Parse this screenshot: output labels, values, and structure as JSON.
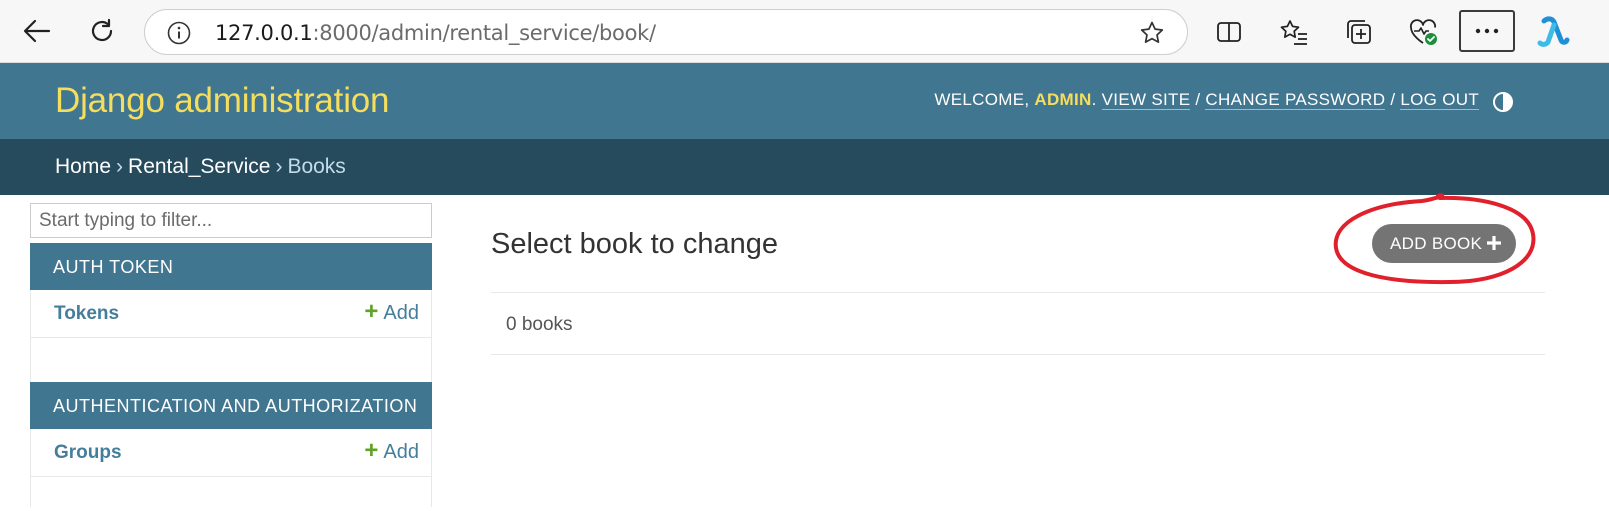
{
  "browser": {
    "url_host": "127.0.0.1",
    "url_path": ":8000/admin/rental_service/book/"
  },
  "header": {
    "branding": "Django administration",
    "welcome": "WELCOME,",
    "username": "ADMIN",
    "view_site": "VIEW SITE",
    "change_password": "CHANGE PASSWORD",
    "log_out": "LOG OUT",
    "sep": "/"
  },
  "breadcrumbs": {
    "home": "Home",
    "app": "Rental_Service",
    "current": "Books",
    "sep": "›"
  },
  "sidebar": {
    "filter_placeholder": "Start typing to filter...",
    "modules": [
      {
        "caption": "AUTH TOKEN",
        "models": [
          {
            "name": "Tokens",
            "add_label": "Add"
          }
        ]
      },
      {
        "caption": "AUTHENTICATION AND AUTHORIZATION",
        "models": [
          {
            "name": "Groups",
            "add_label": "Add"
          }
        ]
      }
    ]
  },
  "content": {
    "title": "Select book to change",
    "add_button": "ADD BOOK",
    "result_count": "0 books"
  },
  "colors": {
    "header_bg": "#417690",
    "breadcrumb_bg": "#264b5d",
    "branding": "#f5dd5d",
    "add_plus": "#5fa225",
    "annotation": "#e0202a"
  }
}
